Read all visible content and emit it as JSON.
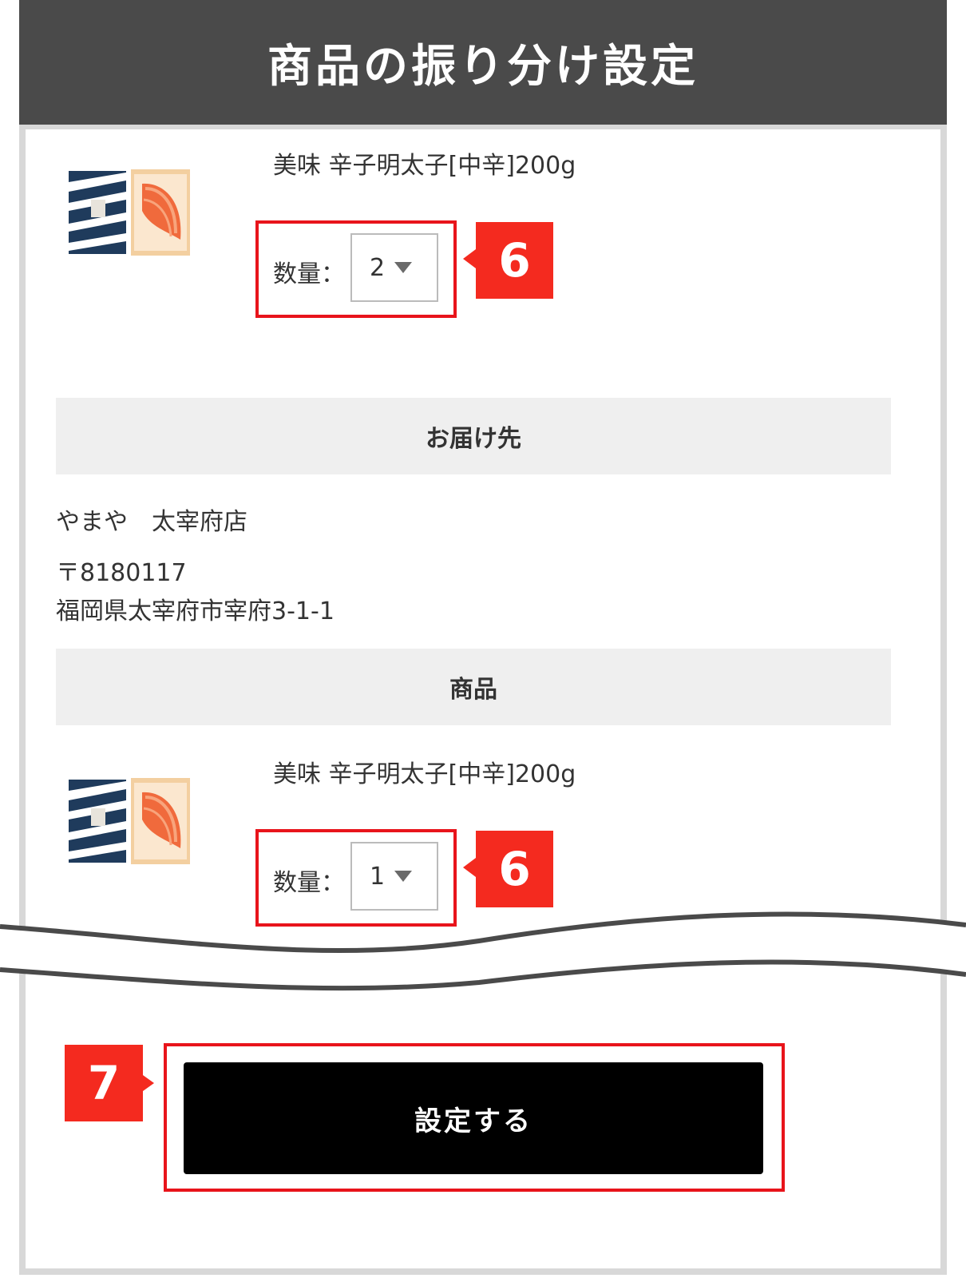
{
  "header": {
    "title": "商品の振り分け設定"
  },
  "items": [
    {
      "name": "美味 辛子明太子[中辛]200g",
      "quantity_label": "数量：",
      "quantity_value": "2",
      "step_marker": "6"
    },
    {
      "name": "美味 辛子明太子[中辛]200g",
      "quantity_label": "数量：",
      "quantity_value": "1",
      "step_marker": "6"
    }
  ],
  "delivery": {
    "section_title": "お届け先",
    "recipient": "やまや　太宰府店",
    "postal_code": "〒8180117",
    "address": "福岡県太宰府市宰府3-1-1"
  },
  "product_section": {
    "title": "商品"
  },
  "submit": {
    "label": "設定する",
    "step_marker": "7"
  },
  "colors": {
    "header_bg": "#4a4a4a",
    "accent_red": "#f42a1f",
    "button_bg": "#000000",
    "section_bg": "#efefef"
  },
  "icons": {
    "dropdown": "caret-down-icon",
    "product_image": "mentaiko-package-thumbnail"
  }
}
